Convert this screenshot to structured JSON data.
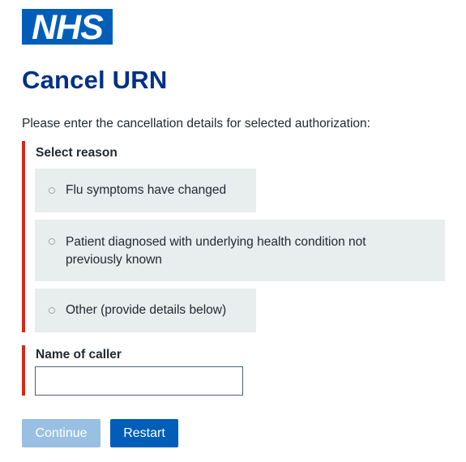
{
  "brand": {
    "logo_text": "NHS",
    "color_blue": "#005eb8",
    "color_dark_blue": "#003087",
    "color_error": "#d5281b"
  },
  "page": {
    "title": "Cancel URN",
    "intro": "Please enter the cancellation details for selected authorization:"
  },
  "reason": {
    "label": "Select reason",
    "options": [
      {
        "label": "Flu symptoms have changed",
        "selected": false
      },
      {
        "label": "Patient diagnosed with underlying health condition not previously known",
        "selected": false
      },
      {
        "label": "Other (provide details below)",
        "selected": false
      }
    ]
  },
  "caller": {
    "label": "Name of caller",
    "value": ""
  },
  "actions": {
    "continue_label": "Continue",
    "continue_disabled": true,
    "restart_label": "Restart"
  }
}
